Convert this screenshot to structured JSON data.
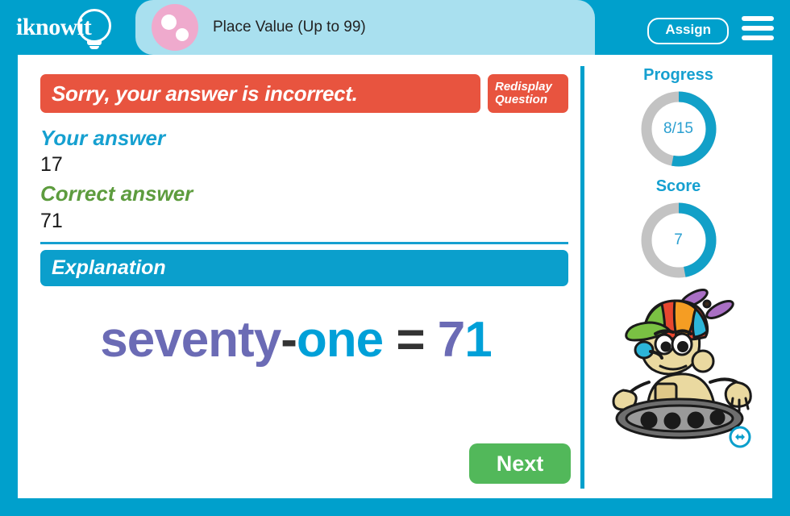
{
  "header": {
    "logo_text": "iknowit",
    "logo_icon": "lightbulb-icon",
    "tab_icon": "pink-dots-icon",
    "tab_title": "Place Value (Up to 99)",
    "assign_label": "Assign",
    "menu_icon": "hamburger-menu-icon",
    "brand_color": "#00a0cc",
    "tab_color": "#a9e0ef",
    "tab_icon_color": "#efaacd"
  },
  "feedback": {
    "banner_text": "Sorry, your answer is incorrect.",
    "banner_color": "#e8543f",
    "redisplay_line1": "Redisplay",
    "redisplay_line2": "Question"
  },
  "answers": {
    "your_label": "Your answer",
    "your_value": "17",
    "your_label_color": "#16a0d0",
    "correct_label": "Correct answer",
    "correct_value": "71",
    "correct_label_color": "#5d9c3e"
  },
  "explanation": {
    "header": "Explanation",
    "header_color": "#0b9fcc",
    "equation": {
      "word_tens": "seventy",
      "hyphen": "-",
      "word_ones": "one",
      "equals": "=",
      "digit_tens": "7",
      "digit_ones": "1",
      "color_tens": "#6b6bb5",
      "color_ones": "#00a0d8",
      "color_operator": "#333333"
    }
  },
  "actions": {
    "next_label": "Next",
    "next_color": "#52b85a"
  },
  "sidebar": {
    "progress": {
      "title": "Progress",
      "value_text": "8/15",
      "completed": 8,
      "total": 15,
      "percent": 53,
      "arc_color": "#12a0c8",
      "track_color": "#c3c3c3"
    },
    "score": {
      "title": "Score",
      "value_text": "7",
      "value": 7,
      "percent": 47,
      "arc_color": "#12a0c8",
      "track_color": "#c3c3c3"
    },
    "mascot_icon": "robot-mascot-with-propeller-cap",
    "resize_icon": "resize-horizontal-icon"
  }
}
